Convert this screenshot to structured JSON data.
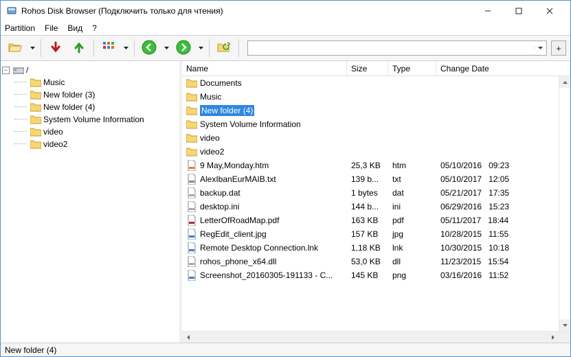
{
  "window": {
    "title": "Rohos Disk Browser (Подключить только для чтения)"
  },
  "menu": {
    "partition": "Partition",
    "file": "File",
    "view": "Вид",
    "help": "?"
  },
  "toolbar": {
    "address_value": ""
  },
  "tree": {
    "root_label": "/",
    "items": [
      "Music",
      "New folder (3)",
      "New folder (4)",
      "System Volume Information",
      "video",
      "video2"
    ]
  },
  "columns": {
    "name": "Name",
    "size": "Size",
    "type": "Type",
    "date": "Change Date"
  },
  "files": [
    {
      "name": "Documents",
      "size": "",
      "type": "",
      "date": "",
      "time": "",
      "kind": "folder",
      "selected": false
    },
    {
      "name": "Music",
      "size": "",
      "type": "",
      "date": "",
      "time": "",
      "kind": "folder",
      "selected": false
    },
    {
      "name": "New folder (4)",
      "size": "",
      "type": "",
      "date": "",
      "time": "",
      "kind": "folder",
      "selected": true
    },
    {
      "name": "System Volume Information",
      "size": "",
      "type": "",
      "date": "",
      "time": "",
      "kind": "folder",
      "selected": false
    },
    {
      "name": "video",
      "size": "",
      "type": "",
      "date": "",
      "time": "",
      "kind": "folder",
      "selected": false
    },
    {
      "name": "video2",
      "size": "",
      "type": "",
      "date": "",
      "time": "",
      "kind": "folder",
      "selected": false
    },
    {
      "name": "9 May,Monday.htm",
      "size": "25,3 KB",
      "type": "htm",
      "date": "05/10/2016",
      "time": "09:23",
      "kind": "htm",
      "selected": false
    },
    {
      "name": "AlexIbanEurMAIB.txt",
      "size": "139 b...",
      "type": "txt",
      "date": "05/10/2017",
      "time": "12:05",
      "kind": "txt",
      "selected": false
    },
    {
      "name": "backup.dat",
      "size": "1 bytes",
      "type": "dat",
      "date": "05/21/2017",
      "time": "17:35",
      "kind": "dat",
      "selected": false
    },
    {
      "name": "desktop.ini",
      "size": "144 b...",
      "type": "ini",
      "date": "06/29/2016",
      "time": "15:23",
      "kind": "ini",
      "selected": false
    },
    {
      "name": "LetterOfRoadMap.pdf",
      "size": "163 KB",
      "type": "pdf",
      "date": "05/11/2017",
      "time": "18:44",
      "kind": "pdf",
      "selected": false
    },
    {
      "name": "RegEdit_client.jpg",
      "size": "157 KB",
      "type": "jpg",
      "date": "10/28/2015",
      "time": "11:55",
      "kind": "jpg",
      "selected": false
    },
    {
      "name": "Remote Desktop Connection.lnk",
      "size": "1,18 KB",
      "type": "lnk",
      "date": "10/30/2015",
      "time": "10:18",
      "kind": "lnk",
      "selected": false
    },
    {
      "name": "rohos_phone_x64.dll",
      "size": "53,0 KB",
      "type": "dll",
      "date": "11/23/2015",
      "time": "15:54",
      "kind": "dll",
      "selected": false
    },
    {
      "name": "Screenshot_20160305-191133 - C...",
      "size": "145 KB",
      "type": "png",
      "date": "03/16/2016",
      "time": "11:52",
      "kind": "png",
      "selected": false
    }
  ],
  "status": "New folder (4)"
}
